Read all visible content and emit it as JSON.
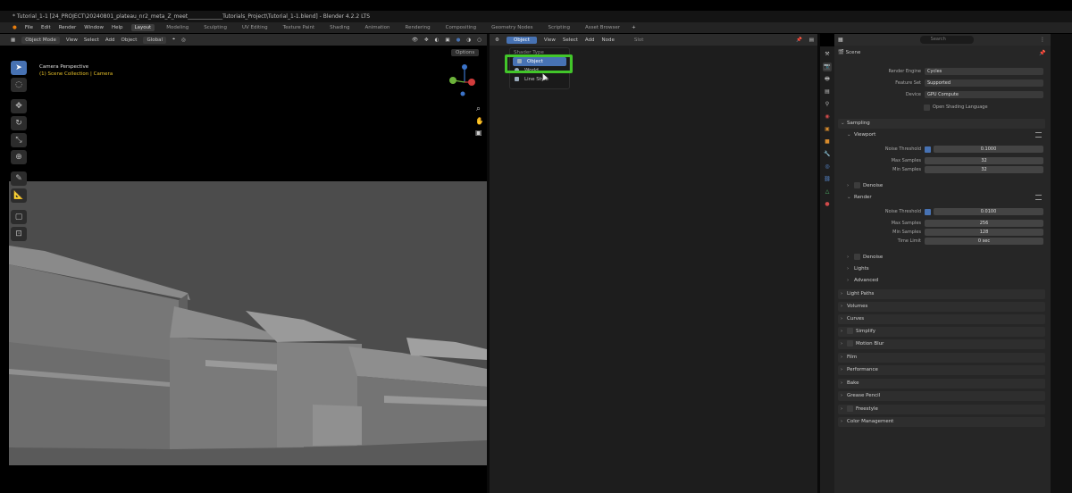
{
  "titlebar": {
    "title": "* Tutorial_1-1 [24_PROJECT\\20240801_plateau_nr2_meta_Z_meet_____________Tutorials_Project\\Tutorial_1-1.blend] - Blender 4.2.2 LTS"
  },
  "menubar": {
    "menus": [
      "File",
      "Edit",
      "Render",
      "Window",
      "Help"
    ],
    "workspaces": [
      "Layout",
      "Modeling",
      "Sculpting",
      "UV Editing",
      "Texture Paint",
      "Shading",
      "Animation",
      "Rendering",
      "Compositing",
      "Geometry Nodes",
      "Scripting",
      "Asset Browser"
    ],
    "active_workspace": "Layout",
    "add_tab": "+"
  },
  "viewport": {
    "mode": "Object Mode",
    "menus": [
      "View",
      "Select",
      "Add",
      "Object"
    ],
    "transform": "Global",
    "options": "Options",
    "info_line1": "Camera Perspective",
    "info_line2": "(1) Scene Collection | Camera",
    "colors": {
      "axis_x": "#d23c3c",
      "axis_y": "#6cb33a",
      "axis_z": "#3b73c8",
      "info_yellow": "#e8c22a",
      "tool_active": "#4772b3"
    }
  },
  "outliner": {
    "header_select": "Object",
    "menus": [
      "View",
      "Select",
      "Add",
      "Node"
    ],
    "slot": "Slot",
    "popup_title": "Shader Type",
    "popup_items": [
      "Object",
      "World",
      "Line Style"
    ],
    "highlight_color": "#42c62a"
  },
  "properties": {
    "search_placeholder": "Search",
    "crumb": "Scene",
    "render_engine_label": "Render Engine",
    "render_engine": "Cycles",
    "feature_set_label": "Feature Set",
    "feature_set": "Supported",
    "device_label": "Device",
    "device": "GPU Compute",
    "osl_label": "Open Shading Language",
    "sampling": "Sampling",
    "viewport": "Viewport",
    "noise_threshold_label": "Noise Threshold",
    "vp_noise": "0.1000",
    "max_samples_label": "Max Samples",
    "vp_max": "32",
    "min_samples_label": "Min Samples",
    "vp_min": "32",
    "denoise": "Denoise",
    "render": "Render",
    "r_noise": "0.0100",
    "r_max": "256",
    "r_min": "128",
    "time_limit_label": "Time Limit",
    "r_time": "0 sec",
    "lights": "Lights",
    "advanced": "Advanced",
    "panels": [
      "Light Paths",
      "Volumes",
      "Curves",
      "Simplify",
      "Motion Blur",
      "Film",
      "Performance",
      "Bake",
      "Grease Pencil",
      "Freestyle",
      "Color Management"
    ]
  }
}
